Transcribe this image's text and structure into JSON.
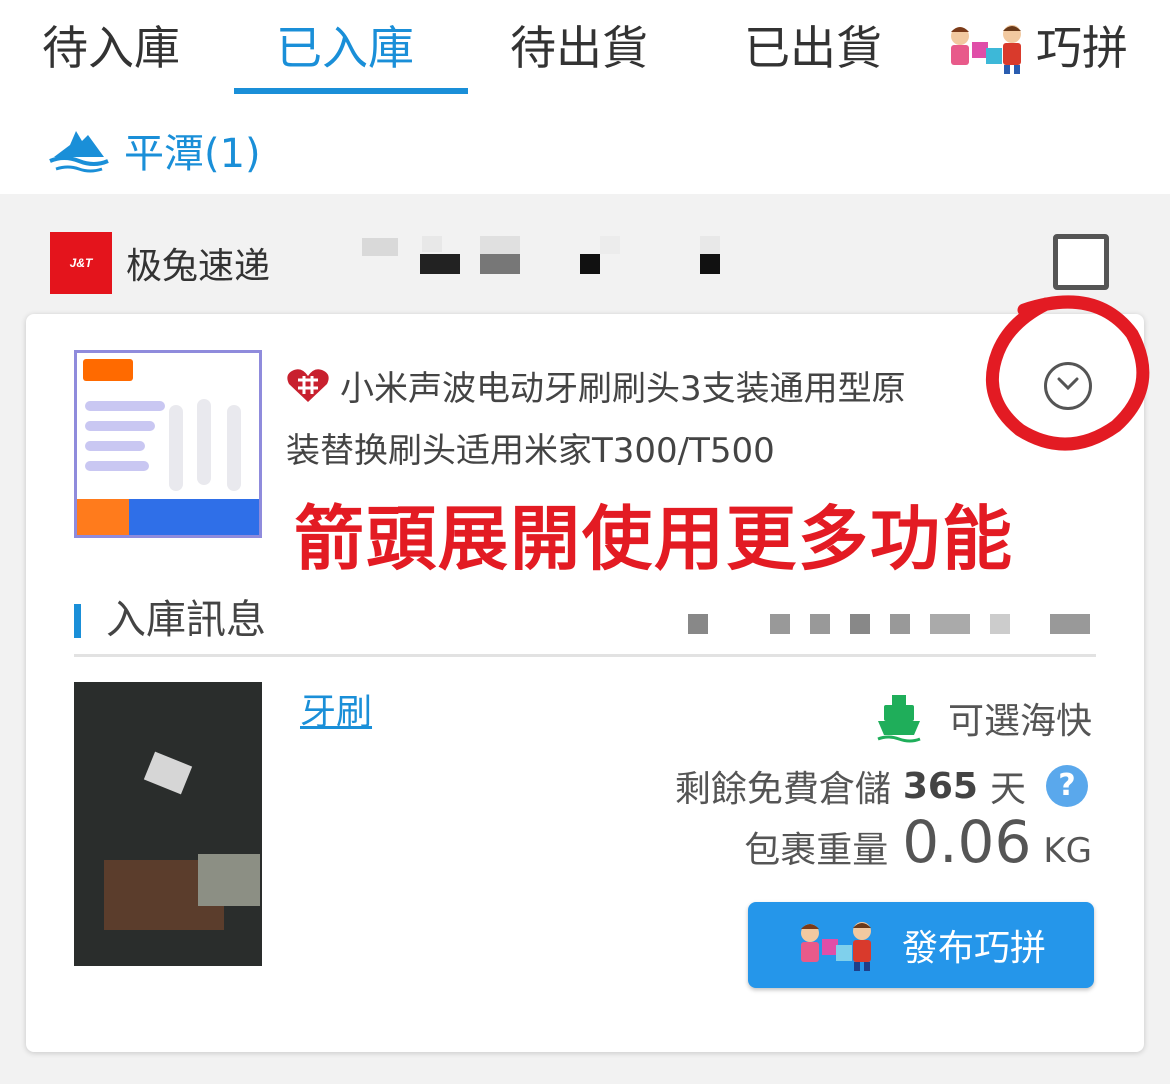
{
  "tabs": [
    {
      "label": "待入庫",
      "active": false
    },
    {
      "label": "已入庫",
      "active": true
    },
    {
      "label": "待出貨",
      "active": false
    },
    {
      "label": "已出貨",
      "active": false
    },
    {
      "label": "巧拼",
      "active": false
    }
  ],
  "region": {
    "label": "平潭(1)",
    "icon": "island-icon"
  },
  "colors": {
    "accent": "#1a8fd8",
    "annotation": "#e31b23",
    "button": "#2596ea"
  },
  "package": {
    "carrier_logo_text": "J&T",
    "carrier_name": "极兔速递",
    "checked": false,
    "product_title_line1": "小米声波电动牙刷刷头3支装通用型原",
    "product_title_line2": "装替换刷头适用米家T300/T500",
    "store_icon": "tmall-icon",
    "annotation": "箭頭展開使用更多功能",
    "section_title": "入庫訊息",
    "item_name": "牙刷",
    "shipping_text": "可選海快",
    "shipping_icon": "ship-icon",
    "storage_prefix": "剩餘免費倉儲",
    "storage_days": "365",
    "storage_unit": "天",
    "weight_label": "包裹重量",
    "weight_value": "0.06",
    "weight_unit": "KG",
    "publish_button": "發布巧拼"
  }
}
